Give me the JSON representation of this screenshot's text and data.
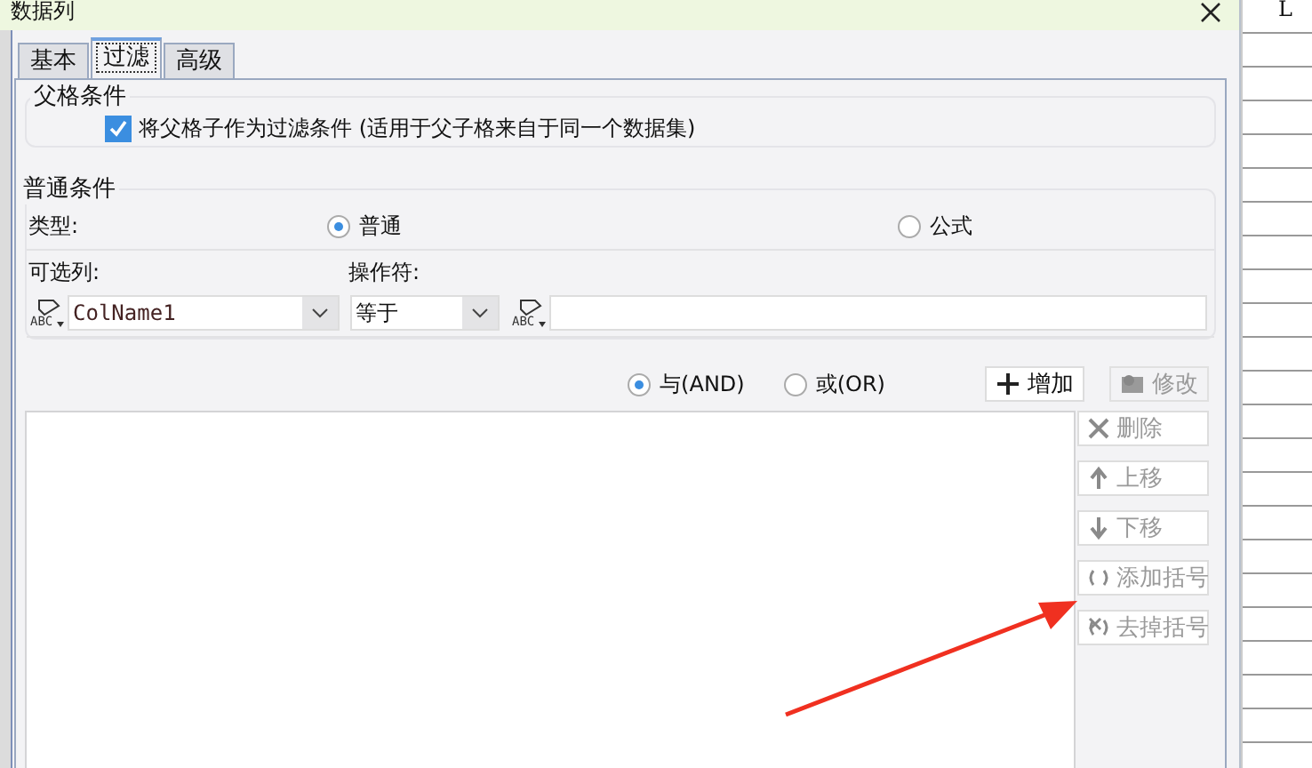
{
  "window": {
    "title": "数据列"
  },
  "spreadsheet": {
    "column_header": "L"
  },
  "tabs": [
    {
      "label": "基本",
      "selected": false
    },
    {
      "label": "过滤",
      "selected": true
    },
    {
      "label": "高级",
      "selected": false
    }
  ],
  "parent_condition": {
    "title": "父格条件",
    "checkbox": {
      "label": "将父格子作为过滤条件 (适用于父子格来自于同一个数据集)",
      "checked": true
    }
  },
  "normal_condition": {
    "title": "普通条件",
    "type_label": "类型:",
    "type_options": [
      {
        "label": "普通",
        "selected": true
      },
      {
        "label": "公式",
        "selected": false
      }
    ],
    "column_label": "可选列:",
    "operator_label": "操作符:",
    "column_select": {
      "value": "ColName1"
    },
    "operator_select": {
      "value": "等于"
    },
    "column_icon_text": "ABC",
    "value_icon_text": "ABC"
  },
  "logic_options": [
    {
      "label": "与(AND)",
      "selected": true
    },
    {
      "label": "或(OR)",
      "selected": false
    }
  ],
  "top_buttons": [
    {
      "kind": "add",
      "label": "增加",
      "disabled": false
    },
    {
      "kind": "edit",
      "label": "修改",
      "disabled": true
    }
  ],
  "side_buttons": [
    {
      "kind": "delete",
      "label": "删除",
      "disabled": true
    },
    {
      "kind": "up",
      "label": "上移",
      "disabled": true
    },
    {
      "kind": "down",
      "label": "下移",
      "disabled": true
    },
    {
      "kind": "add_paren",
      "label": "添加括号",
      "disabled": true
    },
    {
      "kind": "remove_paren",
      "label": "去掉括号",
      "disabled": true
    }
  ]
}
